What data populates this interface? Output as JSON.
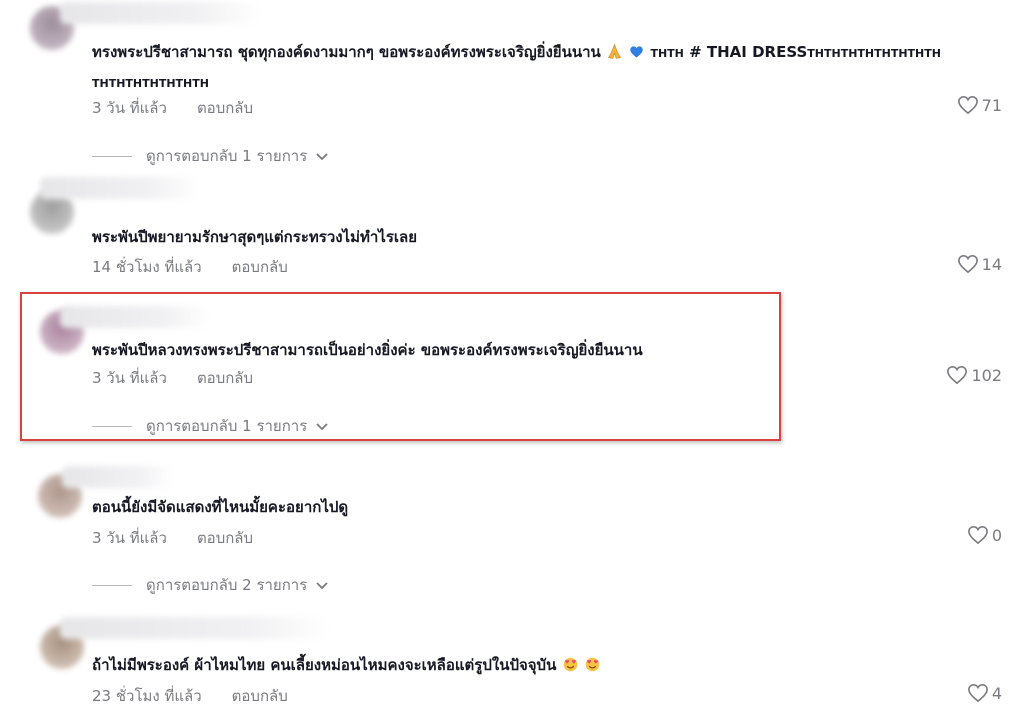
{
  "comments": [
    {
      "text": "ทรงพระปรีชาสามารถ ชุดทุกองค์ดงามมากๆ ขอพระองค์ทรงพระเจริญยิ่งยืนนาน",
      "text_tail_small": "THTH",
      "text_tail_big": "# THAI DRESS",
      "text_tail_small2": "THTHTHTHTHTHTHTH",
      "text_line2": "THTHTHTHTHTHTH",
      "time": "3 วัน ที่แล้ว",
      "reply": "ตอบกลับ",
      "likes": "71",
      "view_replies": "ดูการตอบกลับ 1 รายการ"
    },
    {
      "text": "พระพันปีพยายามรักษาสุดๆแต่กระทรวงไม่ทำไรเลย",
      "time": "14 ชั่วโมง ที่แล้ว",
      "reply": "ตอบกลับ",
      "likes": "14"
    },
    {
      "text": "พระพันปีหลวงทรงพระปรีชาสามารถเป็นอย่างยิ่งค่ะ ขอพระองค์ทรงพระเจริญยิ่งยืนนาน",
      "time": "3 วัน ที่แล้ว",
      "reply": "ตอบกลับ",
      "likes": "102",
      "view_replies": "ดูการตอบกลับ 1 รายการ"
    },
    {
      "text": "ตอนนี้ยังมีจัดแสดงที่ไหนมั้ยคะอยากไปดู",
      "time": "3 วัน ที่แล้ว",
      "reply": "ตอบกลับ",
      "likes": "0",
      "view_replies": "ดูการตอบกลับ 2 รายการ"
    },
    {
      "text": "ถ้าไม่มีพระองค์ ผ้าไหมไทย คนเลี้ยงหม่อนไหมคงจะเหลือแต่รูปในปัจจุบัน",
      "time": "23 ชั่วโมง ที่แล้ว",
      "reply": "ตอบกลับ",
      "likes": "4"
    }
  ],
  "colors": {
    "highlight_border": "#d9433f",
    "meta_text": "#7a7b80",
    "comment_text": "#161823"
  },
  "icons": [
    "heart-icon",
    "chevron-down-icon",
    "praying-hands-emoji",
    "blue-heart-emoji",
    "smiling-face-with-hearts-emoji"
  ]
}
